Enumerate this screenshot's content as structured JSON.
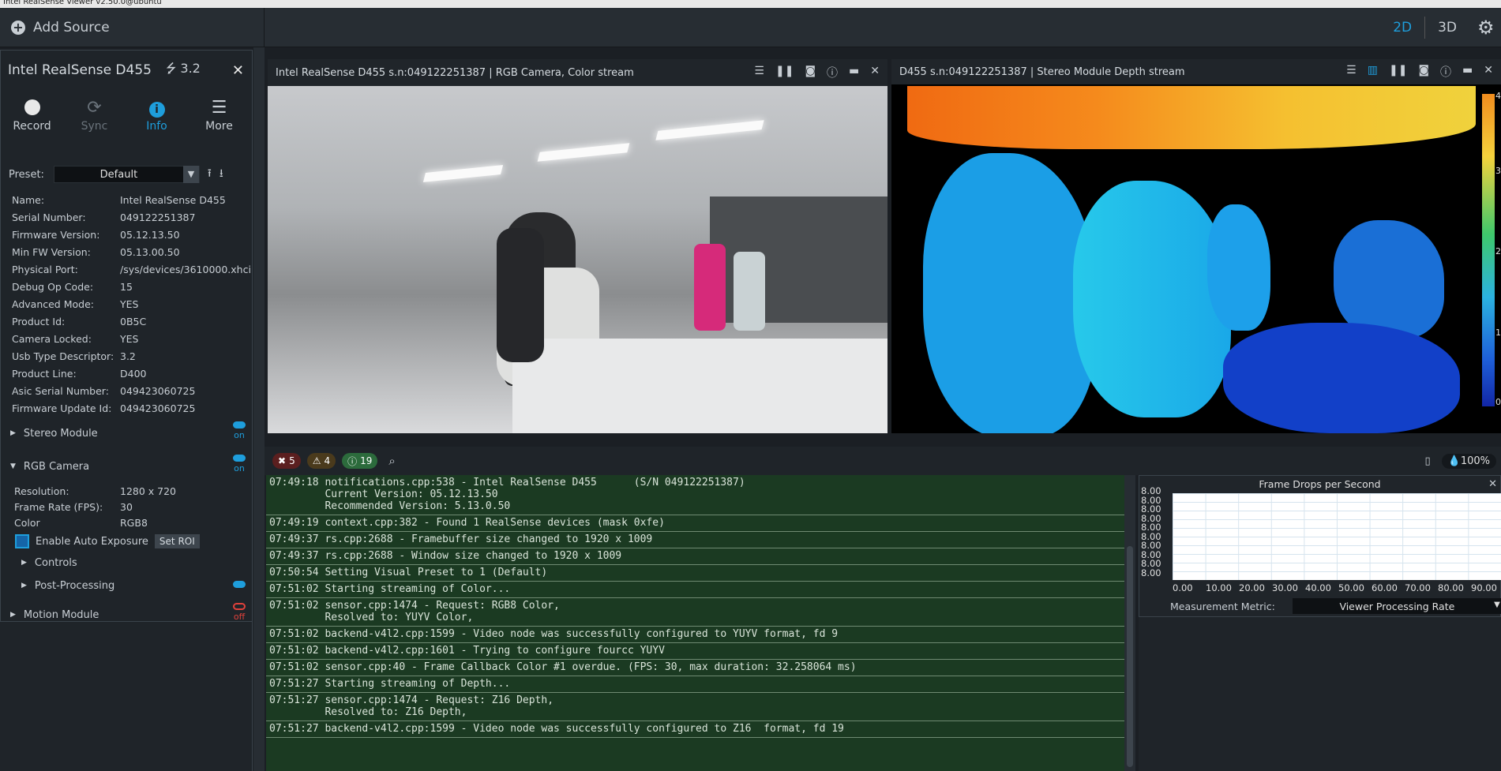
{
  "window": {
    "title": "Intel RealSense Viewer v2.50.0@ubuntu"
  },
  "topbar": {
    "add_source": "Add Source",
    "view_2d": "2D",
    "view_3d": "3D",
    "settings_icon": "gear-icon"
  },
  "device": {
    "name": "Intel RealSense D455",
    "usb": "3.2",
    "actions": [
      {
        "label": "Record",
        "icon": "record-icon"
      },
      {
        "label": "Sync",
        "icon": "sync-icon"
      },
      {
        "label": "Info",
        "icon": "info-icon"
      },
      {
        "label": "More",
        "icon": "menu-icon"
      }
    ],
    "preset_label": "Preset:",
    "preset_value": "Default",
    "info": [
      {
        "k": "Name:",
        "v": "Intel RealSense D455"
      },
      {
        "k": "Serial Number:",
        "v": "049122251387"
      },
      {
        "k": "Firmware Version:",
        "v": "05.12.13.50"
      },
      {
        "k": "Min FW Version:",
        "v": "05.13.00.50"
      },
      {
        "k": "Physical Port:",
        "v": "/sys/devices/3610000.xhci"
      },
      {
        "k": "Debug Op Code:",
        "v": "15"
      },
      {
        "k": "Advanced Mode:",
        "v": "YES"
      },
      {
        "k": "Product Id:",
        "v": "0B5C"
      },
      {
        "k": "Camera Locked:",
        "v": "YES"
      },
      {
        "k": "Usb Type Descriptor:",
        "v": "3.2"
      },
      {
        "k": "Product Line:",
        "v": "D400"
      },
      {
        "k": "Asic Serial Number:",
        "v": "049423060725"
      },
      {
        "k": "Firmware Update Id:",
        "v": "049423060725"
      }
    ],
    "stereo_module": {
      "label": "Stereo Module",
      "state": "on"
    },
    "rgb_camera": {
      "label": "RGB Camera",
      "state": "on",
      "resolution_k": "Resolution:",
      "resolution_v": "1280 x 720",
      "fps_k": "Frame Rate (FPS):",
      "fps_v": "30",
      "color_k": "Color",
      "color_v": "RGB8",
      "auto_exposure": "Enable Auto Exposure",
      "set_roi": "Set ROI",
      "controls": "Controls",
      "post_processing": "Post-Processing"
    },
    "motion_module": {
      "label": "Motion Module",
      "state": "off"
    }
  },
  "streams": {
    "rgb_title": "Intel RealSense D455 s.n:049122251387 | RGB Camera, Color stream",
    "depth_title": "D455 s.n:049122251387 | Stereo Module Depth stream",
    "colorbar_ticks": [
      "4",
      "3",
      "2",
      "1",
      "0"
    ]
  },
  "logbar": {
    "errors": "5",
    "warnings": "4",
    "infos": "19",
    "opacity": "100%"
  },
  "log": [
    "07:49:18 notifications.cpp:538 - Intel RealSense D455      (S/N 049122251387)\n         Current Version: 05.12.13.50\n         Recommended Version: 5.13.0.50",
    "07:49:19 context.cpp:382 - Found 1 RealSense devices (mask 0xfe)",
    "07:49:37 rs.cpp:2688 - Framebuffer size changed to 1920 x 1009",
    "07:49:37 rs.cpp:2688 - Window size changed to 1920 x 1009",
    "07:50:54 Setting Visual Preset to 1 (Default)",
    "07:51:02 Starting streaming of Color...",
    "07:51:02 sensor.cpp:1474 - Request: RGB8 Color,\n         Resolved to: YUYV Color,",
    "07:51:02 backend-v4l2.cpp:1599 - Video node was successfully configured to YUYV format, fd 9",
    "07:51:02 backend-v4l2.cpp:1601 - Trying to configure fourcc YUYV",
    "07:51:02 sensor.cpp:40 - Frame Callback Color #1 overdue. (FPS: 30, max duration: 32.258064 ms)",
    "07:51:27 Starting streaming of Depth...",
    "07:51:27 sensor.cpp:1474 - Request: Z16 Depth,\n         Resolved to: Z16 Depth,",
    "07:51:27 backend-v4l2.cpp:1599 - Video node was successfully configured to Z16  format, fd 19"
  ],
  "metrics": {
    "title": "Frame Drops per Second",
    "metric_label": "Measurement Metric:",
    "metric_value": "Viewer Processing Rate"
  },
  "chart_data": {
    "type": "line",
    "title": "Frame Drops per Second",
    "y_tick_labels": [
      "8.00",
      "8.00",
      "8.00",
      "8.00",
      "8.00",
      "8.00",
      "8.00",
      "8.00",
      "8.00",
      "8.00"
    ],
    "x_tick_labels": [
      "0.00",
      "10.00",
      "20.00",
      "30.00",
      "40.00",
      "50.00",
      "60.00",
      "70.00",
      "80.00",
      "90.00"
    ],
    "series": []
  }
}
